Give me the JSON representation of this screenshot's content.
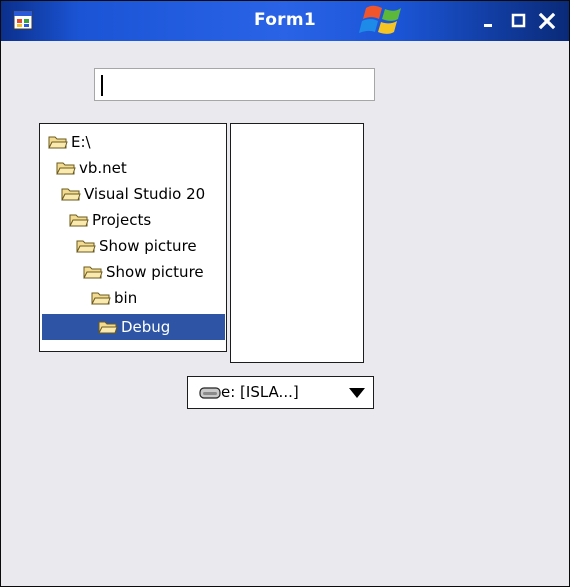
{
  "window": {
    "title": "Form1"
  },
  "textbox": {
    "value": ""
  },
  "dir_list": {
    "items": [
      {
        "label": "E:\\"
      },
      {
        "label": "vb.net"
      },
      {
        "label": "Visual Studio 20"
      },
      {
        "label": "Projects"
      },
      {
        "label": "Show picture"
      },
      {
        "label": "Show picture"
      },
      {
        "label": "bin"
      },
      {
        "label": "Debug"
      }
    ],
    "selected_index": 7
  },
  "file_list": {
    "items": []
  },
  "drive_list": {
    "selected": "e: [ISLA...]"
  },
  "colors": {
    "titlebar": "#1b55d6",
    "form_background": "#e9e9ee",
    "selection": "#2e55a5",
    "folder": "#f3dc92"
  },
  "icons": {
    "app": "form-app-icon",
    "logo": "windows-flag-logo",
    "folder": "open-folder-icon",
    "drive": "hard-drive-icon",
    "dropdown": "dropdown-arrow-icon"
  }
}
